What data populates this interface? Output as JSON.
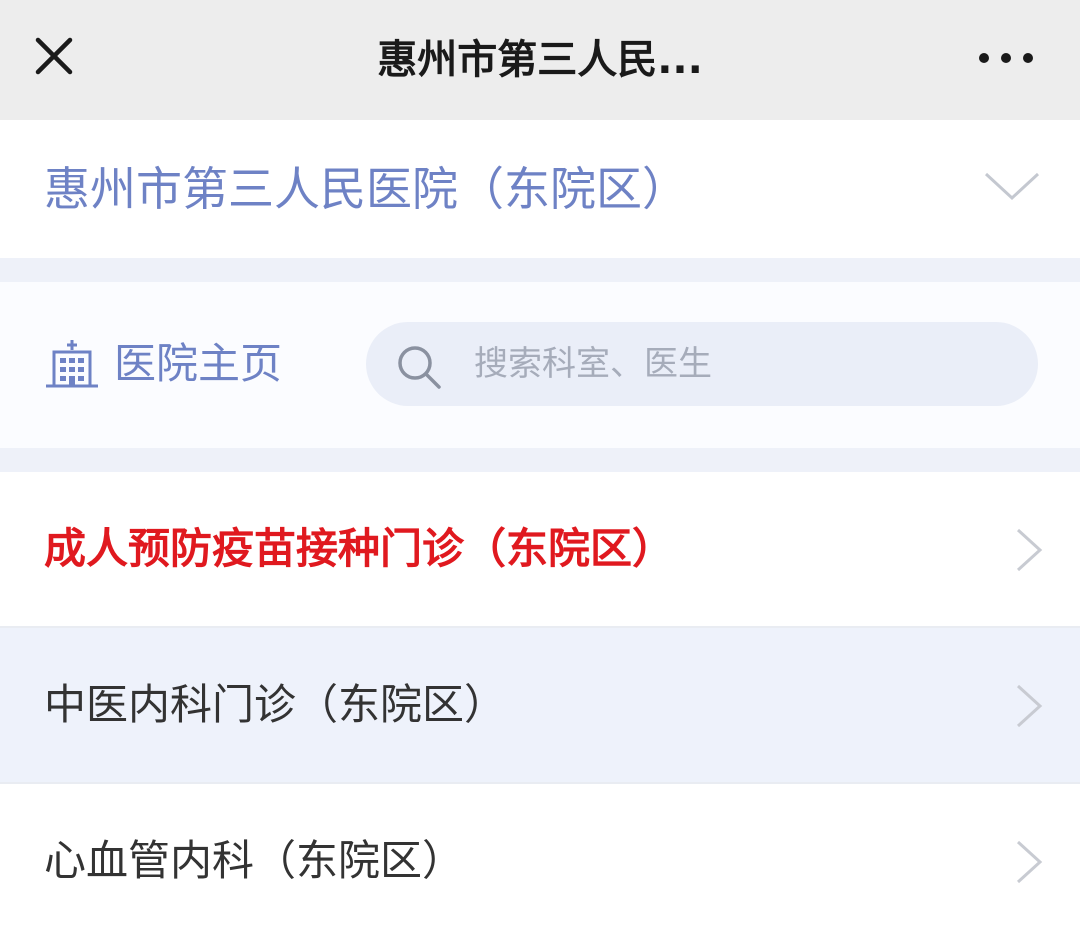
{
  "header": {
    "title": "惠州市第三人民...",
    "close_icon": "close-icon",
    "more_icon": "more-icon"
  },
  "hospital_selector": {
    "name": "惠州市第三人民医院（东院区）",
    "icon": "chevron-down-icon"
  },
  "toolbar": {
    "home_label": "医院主页",
    "home_icon": "hospital-building-icon",
    "search_placeholder": "搜索科室、医生",
    "search_icon": "search-icon"
  },
  "departments": [
    {
      "label": "成人预防疫苗接种门诊（东院区）",
      "highlighted": true
    },
    {
      "label": "中医内科门诊（东院区）",
      "highlighted": false
    },
    {
      "label": "心血管内科（东院区）",
      "highlighted": false
    }
  ],
  "colors": {
    "accent": "#6e82c5",
    "highlight": "#e0191f",
    "text": "#333333",
    "topbar": "#ededed",
    "search_bg": "#eaeef8"
  }
}
